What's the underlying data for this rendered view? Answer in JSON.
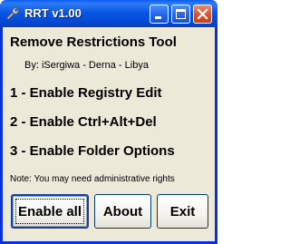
{
  "window": {
    "title": "RRT v1.00",
    "icon": "wrench-icon"
  },
  "titlebar_buttons": {
    "minimize": "minimize-icon",
    "maximize": "maximize-icon",
    "close": "close-icon"
  },
  "main": {
    "heading": "Remove Restrictions Tool",
    "byline": "By:  iSergiwa - Derna - Libya",
    "options": [
      "1 - Enable Registry Edit",
      "2 - Enable Ctrl+Alt+Del",
      "3 - Enable Folder Options"
    ],
    "note": "Note: You may need administrative rights"
  },
  "buttons": {
    "enable_all": "Enable all",
    "about": "About",
    "exit": "Exit"
  },
  "colors": {
    "titlebar": "#0a58e6",
    "window_frame": "#0831d9",
    "client_bg": "#ece9d8",
    "close_button": "#d6532d"
  }
}
